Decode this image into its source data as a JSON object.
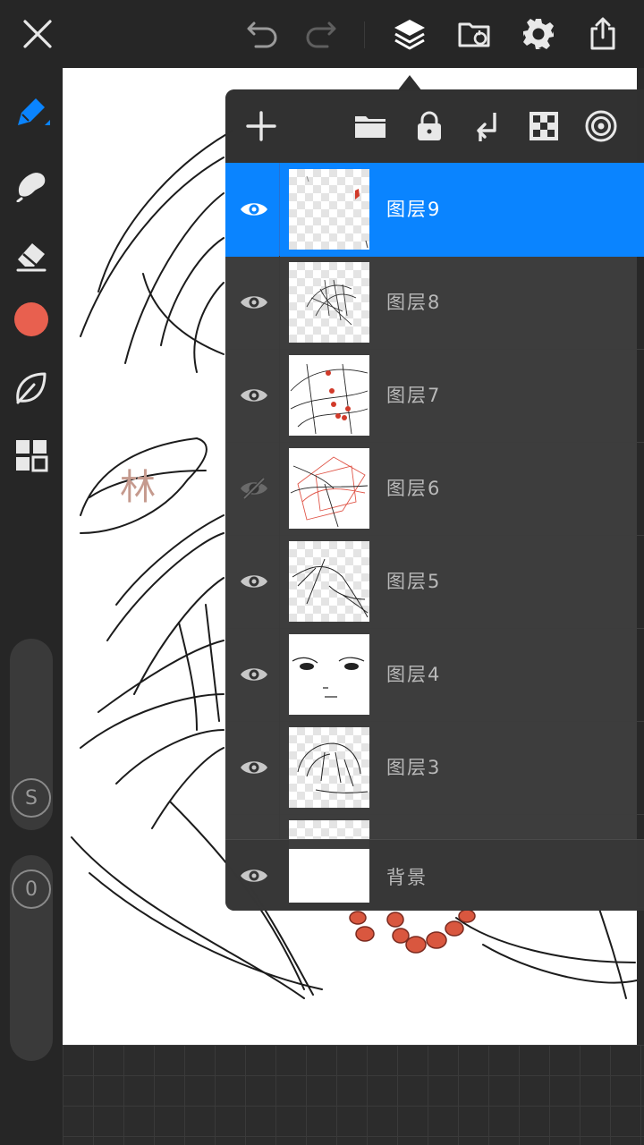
{
  "toolbar": {
    "close_icon": "close-icon",
    "undo_icon": "undo-icon",
    "redo_icon": "redo-icon",
    "layers_icon": "layers-icon",
    "gallery_icon": "gallery-folder-icon",
    "settings_icon": "gear-icon",
    "share_icon": "share-icon"
  },
  "tools": [
    {
      "name": "brush",
      "icon": "pen-icon",
      "active": true
    },
    {
      "name": "smudge",
      "icon": "smudge-icon"
    },
    {
      "name": "eraser",
      "icon": "eraser-icon"
    },
    {
      "name": "color",
      "icon": "color-swatch",
      "color": "#e8604f"
    },
    {
      "name": "brush-library",
      "icon": "leaf-icon"
    },
    {
      "name": "more",
      "icon": "grid-icon"
    }
  ],
  "sliders": {
    "size_label": "S",
    "opacity_label": "0"
  },
  "layers_panel": {
    "header_icons": [
      "add-icon",
      "folder-icon",
      "lock-icon",
      "merge-down-icon",
      "transparency-icon",
      "effects-icon"
    ],
    "layers": [
      {
        "name": "图层9",
        "visible": true,
        "active": true
      },
      {
        "name": "图层8",
        "visible": true,
        "active": false
      },
      {
        "name": "图层7",
        "visible": true,
        "active": false
      },
      {
        "name": "图层6",
        "visible": false,
        "active": false
      },
      {
        "name": "图层5",
        "visible": true,
        "active": false
      },
      {
        "name": "图层4",
        "visible": true,
        "active": false
      },
      {
        "name": "图层3",
        "visible": true,
        "active": false
      }
    ],
    "background": {
      "name": "背景",
      "visible": true
    }
  },
  "canvas_annotation": "林",
  "colors": {
    "accent": "#0a84ff",
    "current_color": "#e8604f"
  }
}
